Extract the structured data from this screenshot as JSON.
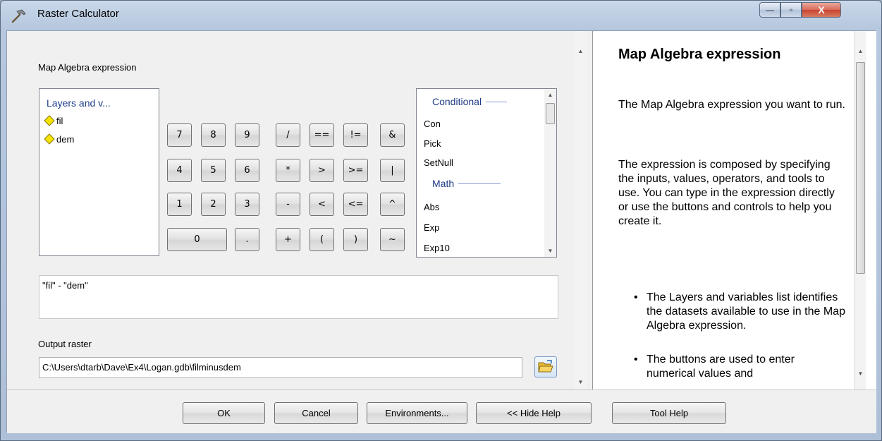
{
  "window": {
    "title": "Raster Calculator",
    "controls": {
      "minimize": "—",
      "maximize": "▫",
      "close": "X"
    }
  },
  "expression_section": {
    "label": "Map Algebra expression",
    "layers_header": "Layers and v...",
    "layers": [
      "fil",
      "dem"
    ],
    "keypad": [
      [
        "7",
        "8",
        "9",
        "/",
        "==",
        "!=",
        "&"
      ],
      [
        "4",
        "5",
        "6",
        "*",
        ">",
        ">=",
        "|"
      ],
      [
        "1",
        "2",
        "3",
        "-",
        "<",
        "<=",
        "^"
      ],
      [
        "0",
        ".",
        "+",
        "(",
        ")",
        "~"
      ]
    ],
    "function_categories": [
      {
        "name": "Conditional",
        "items": [
          "Con",
          "Pick",
          "SetNull"
        ]
      },
      {
        "name": "Math",
        "items": [
          "Abs",
          "Exp",
          "Exp10"
        ]
      }
    ],
    "expression_value": "\"fil\" - \"dem\""
  },
  "output": {
    "label": "Output raster",
    "value": "C:\\Users\\dtarb\\Dave\\Ex4\\Logan.gdb\\filminusdem"
  },
  "help": {
    "title": "Map Algebra expression",
    "paragraphs": [
      "The Map Algebra expression you want to run.",
      "The expression is composed by specifying the inputs, values, operators, and tools to use. You can type in the expression directly or use the buttons and controls to help you create it."
    ],
    "bullets": [
      "The Layers and variables list identifies the datasets available to use in the Map Algebra expression.",
      "The buttons are used to enter numerical values and"
    ]
  },
  "buttons": {
    "ok": "OK",
    "cancel": "Cancel",
    "environments": "Environments...",
    "hide_help": "<< Hide Help",
    "tool_help": "Tool Help"
  },
  "icons": {
    "title": "hammer-icon",
    "layer": "raster-layer-diamond-icon",
    "browse": "open-folder-icon"
  },
  "colors": {
    "layer_diamond": "#f5e400",
    "category_text": "#1f3c88",
    "close_button": "#c7442f"
  }
}
